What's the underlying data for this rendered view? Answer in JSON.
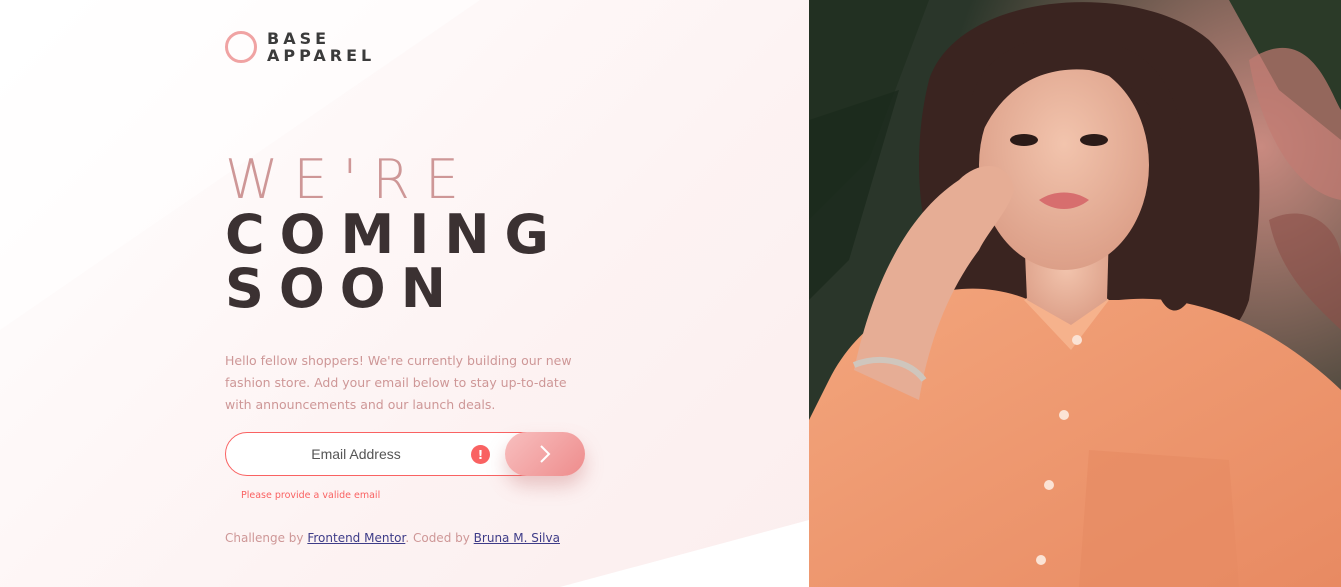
{
  "logo": {
    "line1": "BASE",
    "line2": "APPAREL"
  },
  "headline": {
    "light": "WE'RE",
    "dark1": "COMING",
    "dark2": "SOON"
  },
  "description": "Hello fellow shoppers! We're currently building our new fashion store. Add your email below to stay up-to-date with announcements and our launch deals.",
  "form": {
    "email_placeholder": "Email Address",
    "error_icon": "!",
    "submit_icon": "chevron-right-icon",
    "error_message": "Please provide a valide email"
  },
  "footer": {
    "prefix": "Challenge by ",
    "link1": "Frontend Mentor",
    "middle": ". Coded by ",
    "link2": "Bruna M. Silva"
  },
  "colors": {
    "accent": "#ce9797",
    "dark": "#3b3132",
    "error": "#f96262",
    "gradient_start": "#f8bfbf",
    "gradient_end": "#ee8c8c"
  }
}
